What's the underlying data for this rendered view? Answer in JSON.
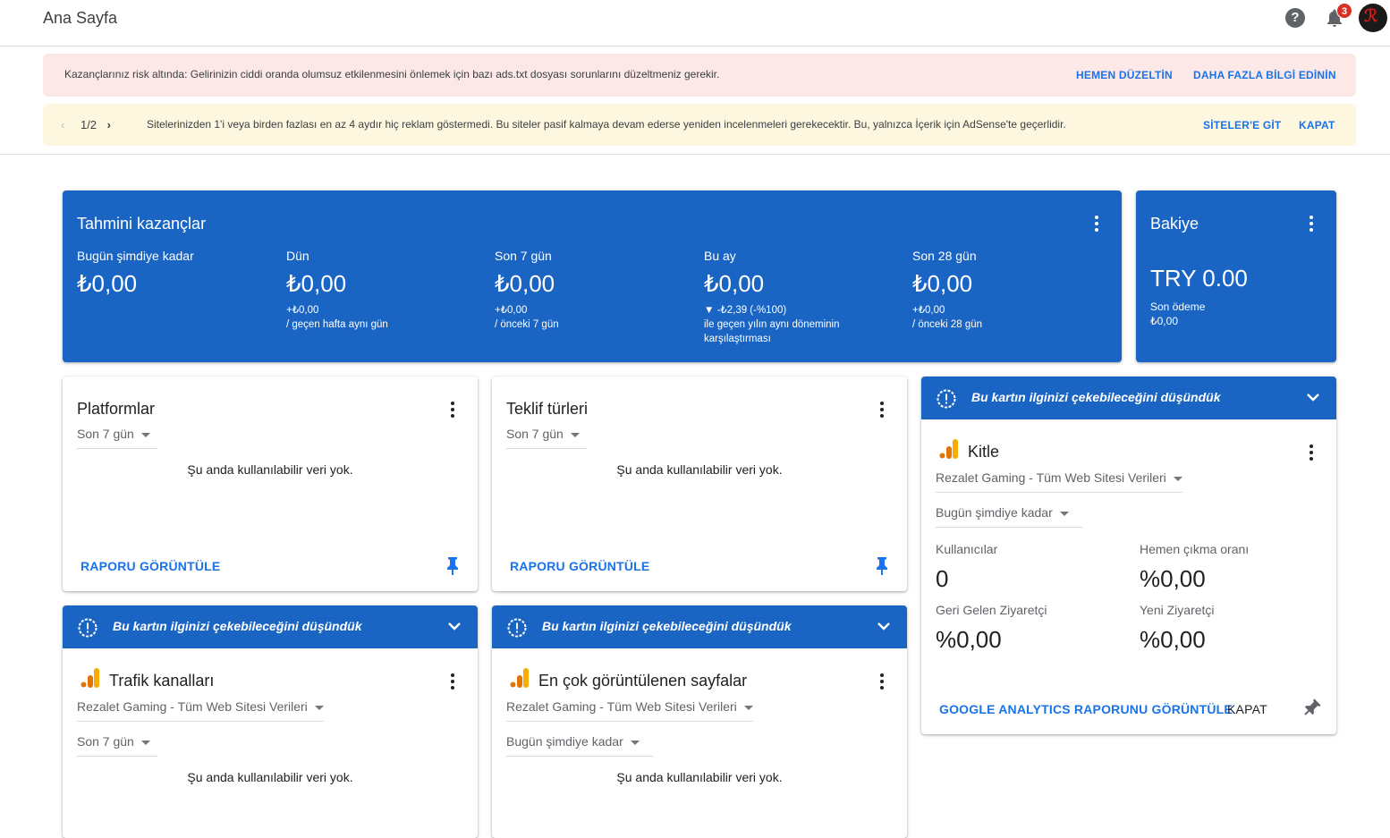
{
  "header": {
    "title": "Ana Sayfa",
    "notification_count": "3"
  },
  "alerts": {
    "risk": {
      "message": "Kazançlarınız risk altında: Gelirinizin ciddi oranda olumsuz etkilenmesini önlemek için bazı ads.txt dosyası sorunlarını düzeltmeniz gerekir.",
      "action1": "HEMEN DÜZELTİN",
      "action2": "DAHA FAZLA BİLGİ EDİNİN"
    },
    "inactive": {
      "pager": "1/2",
      "message": "Sitelerinizden 1'i veya birden fazlası en az 4 aydır hiç reklam göstermedi. Bu siteler pasif kalmaya devam ederse yeniden incelenmeleri gerekecektir. Bu, yalnızca İçerik için AdSense'te geçerlidir.",
      "action1": "SİTELER'E GİT",
      "action2": "KAPAT"
    }
  },
  "earnings": {
    "title": "Tahmini kazançlar",
    "stats": [
      {
        "label": "Bugün şimdiye kadar",
        "value": "₺0,00",
        "sub1": "",
        "sub2": ""
      },
      {
        "label": "Dün",
        "value": "₺0,00",
        "sub1": "+₺0,00",
        "sub2": "/ geçen hafta aynı gün"
      },
      {
        "label": "Son 7 gün",
        "value": "₺0,00",
        "sub1": "+₺0,00",
        "sub2": "/ önceki 7 gün"
      },
      {
        "label": "Bu ay",
        "value": "₺0,00",
        "sub1": "▼ -₺2,39 (-%100)",
        "sub2": "ile geçen yılın aynı döneminin karşılaştırması"
      },
      {
        "label": "Son 28 gün",
        "value": "₺0,00",
        "sub1": "+₺0,00",
        "sub2": "/ önceki 28 gün"
      }
    ]
  },
  "balance": {
    "title": "Bakiye",
    "value": "TRY 0.00",
    "last_payment_label": "Son ödeme",
    "last_payment_value": "₺0,00"
  },
  "platforms": {
    "title": "Platformlar",
    "range": "Son 7 gün",
    "empty": "Şu anda kullanılabilir veri yok.",
    "link": "RAPORU GÖRÜNTÜLE"
  },
  "offers": {
    "title": "Teklif türleri",
    "range": "Son 7 gün",
    "empty": "Şu anda kullanılabilir veri yok.",
    "link": "RAPORU GÖRÜNTÜLE"
  },
  "suggestion_text": "Bu kartın ilginizi çekebileceğini düşündük",
  "audience": {
    "title": "Kitle",
    "property": "Rezalet Gaming - Tüm Web Sitesi Verileri",
    "range": "Bugün şimdiye kadar",
    "metrics": [
      {
        "label": "Kullanıcılar",
        "value": "0"
      },
      {
        "label": "Hemen çıkma oranı",
        "value": "%0,00"
      },
      {
        "label": "Geri Gelen Ziyaretçi",
        "value": "%0,00"
      },
      {
        "label": "Yeni Ziyaretçi",
        "value": "%0,00"
      }
    ],
    "link": "GOOGLE ANALYTICS RAPORUNU GÖRÜNTÜLE",
    "close": "KAPAT"
  },
  "traffic": {
    "title": "Trafik kanalları",
    "property": "Rezalet Gaming - Tüm Web Sitesi Verileri",
    "range": "Son 7 gün",
    "empty": "Şu anda kullanılabilir veri yok."
  },
  "toppages": {
    "title": "En çok görüntülenen sayfalar",
    "property": "Rezalet Gaming - Tüm Web Sitesi Verileri",
    "range": "Bugün şimdiye kadar",
    "empty": "Şu anda kullanılabilir veri yok."
  },
  "colors": {
    "primary_blue": "#1a65c4",
    "link_blue": "#1a73e8",
    "alert_red_bg": "#fce8e6",
    "alert_yellow_bg": "#fef7e0"
  }
}
